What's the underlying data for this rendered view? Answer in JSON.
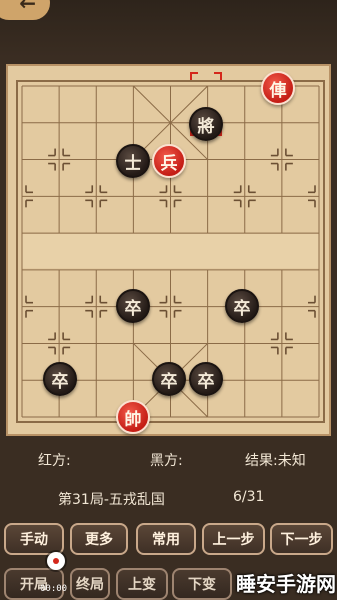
{
  "top": {
    "back_icon": "arrow-left-icon"
  },
  "pieces": [
    {
      "id": "red-chariot",
      "label": "俥",
      "side": "red"
    },
    {
      "id": "black-general",
      "label": "將",
      "side": "black"
    },
    {
      "id": "black-advisor",
      "label": "士",
      "side": "black"
    },
    {
      "id": "red-soldier",
      "label": "兵",
      "side": "red"
    },
    {
      "id": "black-pawn-1",
      "label": "卒",
      "side": "black"
    },
    {
      "id": "black-pawn-2",
      "label": "卒",
      "side": "black"
    },
    {
      "id": "black-pawn-3",
      "label": "卒",
      "side": "black"
    },
    {
      "id": "black-pawn-4",
      "label": "卒",
      "side": "black"
    },
    {
      "id": "black-pawn-5",
      "label": "卒",
      "side": "black"
    },
    {
      "id": "red-king",
      "label": "帥",
      "side": "red"
    }
  ],
  "info": {
    "red_label": "红方:",
    "black_label": "黑方:",
    "result": "结果:未知"
  },
  "game": {
    "title": "第31局-五戎乱国",
    "progress": "6/31"
  },
  "buttons_row1": [
    "手动",
    "更多",
    "常用",
    "上一步",
    "下一步"
  ],
  "buttons_row2": [
    "开局",
    "终局",
    "上变",
    "下变"
  ],
  "overlay": {
    "timer": "00:00"
  },
  "watermark": "睡安手游网",
  "colors": {
    "red": "#d4271b",
    "black": "#231a16",
    "board": "#e3caa0",
    "background": "#3a2d22"
  }
}
